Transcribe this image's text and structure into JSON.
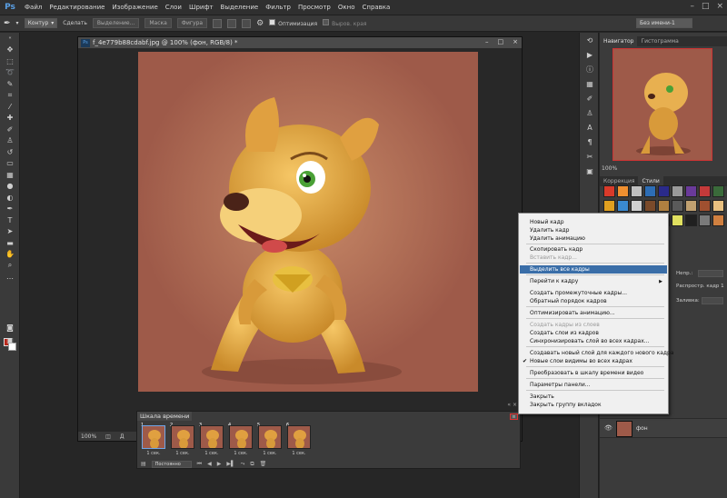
{
  "menubar": {
    "logo": "Ps",
    "items": [
      "Файл",
      "Редактирование",
      "Изображение",
      "Слои",
      "Шрифт",
      "Выделение",
      "Фильтр",
      "Просмотр",
      "Окно",
      "Справка"
    ],
    "window_controls": [
      "–",
      "□",
      "×"
    ]
  },
  "optbar": {
    "mode": "Контур",
    "buttons": [
      "Сделать",
      "Выделение...",
      "Маска",
      "Фигура"
    ],
    "auto_align_label": "Оптимизация",
    "align_edges_label": "Выров. края",
    "workspace": "Без имени-1"
  },
  "document": {
    "ps_badge": "Ps",
    "title": "f_4e779b88cdabf.jpg @ 100% (фон, RGB/8) *",
    "zoom": "100%",
    "status_extra": "Д"
  },
  "timeline": {
    "tab_label": "Шкала времени",
    "collapse_arrows": "« ×",
    "menu_button": "≡",
    "frames": [
      {
        "num": "1",
        "delay": "1 сек."
      },
      {
        "num": "2",
        "delay": "1 сек."
      },
      {
        "num": "3",
        "delay": "1 сек."
      },
      {
        "num": "4",
        "delay": "1 сек."
      },
      {
        "num": "5",
        "delay": "1 сек."
      },
      {
        "num": "6",
        "delay": "1 сек."
      }
    ],
    "loop": "Постоянно"
  },
  "navigator": {
    "tabs": [
      "Навигатор",
      "Гистограмма"
    ],
    "zoom": "100%"
  },
  "styles": {
    "tabs": [
      "Коррекция",
      "Стили"
    ],
    "colors": [
      "#d93a2a",
      "#f09030",
      "#c0c0c0",
      "#2d6db5",
      "#2a2a8a",
      "#9a9a9a",
      "#6a3a9a",
      "#c43a3a",
      "#3a6a3a",
      "#e0a020",
      "#3a8ad0",
      "#d0d0d0",
      "#7a4a2a",
      "#b08040",
      "#5a5a5a",
      "#c0a070",
      "#a05030",
      "#e8c080",
      "#404080",
      "#8ab0d0",
      "#c05050",
      "#305060",
      "#b0b0e0",
      "#e0e060",
      "#202020",
      "#7a7a7a",
      "#d08040"
    ]
  },
  "layers": {
    "opacity_label": "Непр.:",
    "fill_label": "Заливка:",
    "propagate_label": "Распростр. кадр 1",
    "layer_name": "фон"
  },
  "context_menu": {
    "items": [
      {
        "label": "Новый кадр",
        "state": "normal"
      },
      {
        "label": "Удалить кадр",
        "state": "normal"
      },
      {
        "label": "Удалить анимацию",
        "state": "normal"
      },
      {
        "label": "Скопировать кадр",
        "state": "normal"
      },
      {
        "label": "Вставить кадр...",
        "state": "disabled"
      },
      {
        "label": "Выделить все кадры",
        "state": "highlight"
      },
      {
        "label": "Перейти к кадру",
        "state": "normal",
        "submenu": "▶"
      },
      {
        "label": "Создать промежуточные кадры...",
        "state": "normal"
      },
      {
        "label": "Обратный порядок кадров",
        "state": "normal"
      },
      {
        "label": "Оптимизировать анимацию...",
        "state": "normal"
      },
      {
        "label": "Создать кадры из слоев",
        "state": "disabled"
      },
      {
        "label": "Создать слои из кадров",
        "state": "normal"
      },
      {
        "label": "Синхронизировать слой во всех кадрах...",
        "state": "normal"
      },
      {
        "label": "Создавать новый слой для каждого нового кадра",
        "state": "normal"
      },
      {
        "label": "Новые слои видимы во всех кадрах",
        "state": "normal",
        "check": "✔"
      },
      {
        "label": "Преобразовать в шкалу времени видео",
        "state": "normal"
      },
      {
        "label": "Параметры панели...",
        "state": "normal"
      },
      {
        "label": "Закрыть",
        "state": "normal"
      },
      {
        "label": "Закрыть группу вкладок",
        "state": "normal"
      }
    ]
  }
}
